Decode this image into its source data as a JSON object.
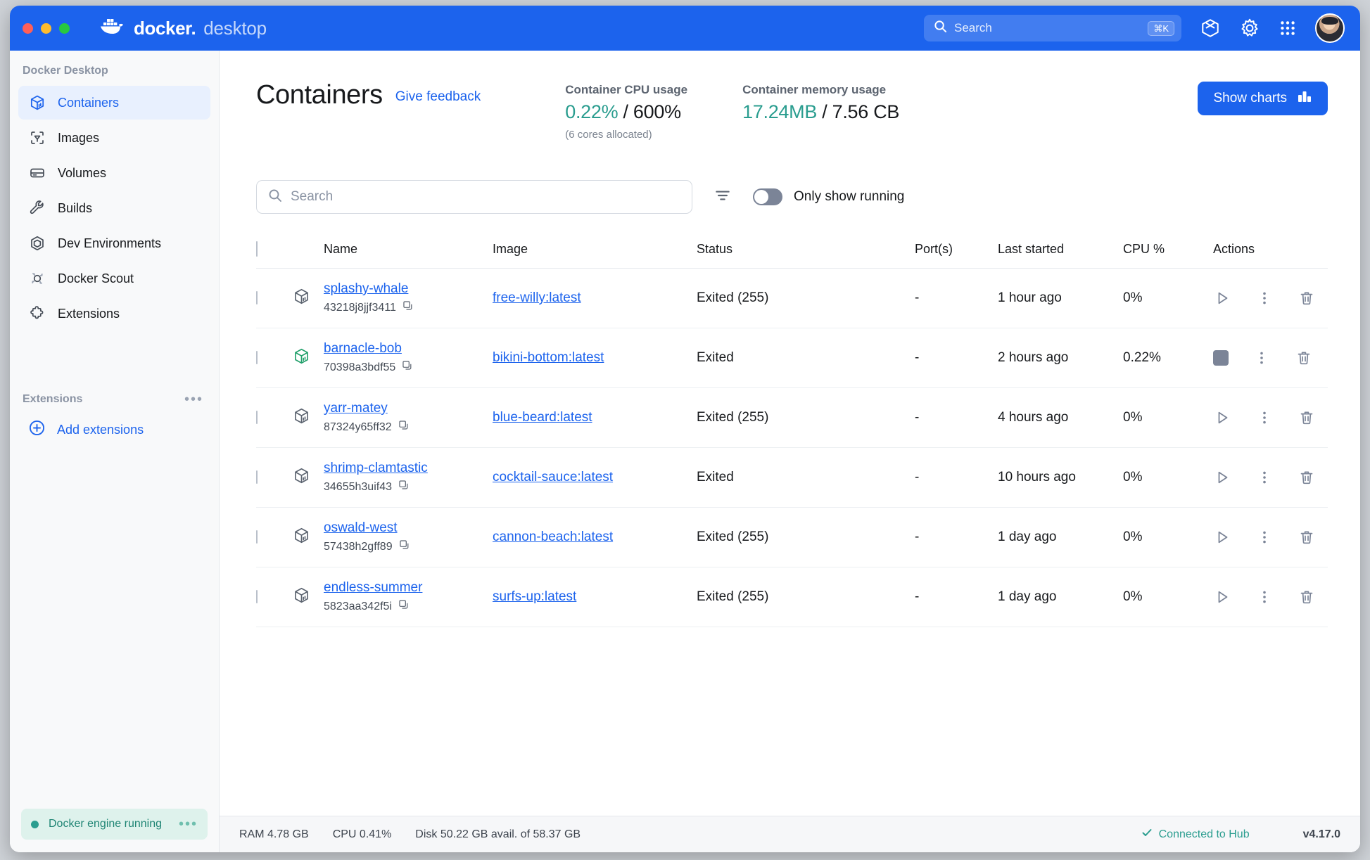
{
  "titlebar": {
    "brand_main": "docker",
    "brand_dot": ".",
    "brand_sub": "desktop",
    "search_placeholder": "Search",
    "search_shortcut": "⌘K",
    "icons": [
      "learning-center-icon",
      "gear-icon",
      "app-grid-icon",
      "avatar"
    ]
  },
  "sidebar": {
    "title": "Docker Desktop",
    "items": [
      {
        "label": "Containers",
        "icon": "container-cube-icon",
        "active": true
      },
      {
        "label": "Images",
        "icon": "images-icon",
        "active": false
      },
      {
        "label": "Volumes",
        "icon": "volumes-icon",
        "active": false
      },
      {
        "label": "Builds",
        "icon": "wrench-icon",
        "active": false
      },
      {
        "label": "Dev Environments",
        "icon": "dev-env-icon",
        "active": false
      },
      {
        "label": "Docker Scout",
        "icon": "scout-icon",
        "active": false
      },
      {
        "label": "Extensions",
        "icon": "puzzle-icon",
        "active": false
      }
    ],
    "extensions_header": "Extensions",
    "add_extensions": "Add extensions",
    "engine_status": "Docker engine running"
  },
  "main": {
    "page_title": "Containers",
    "feedback_link": "Give feedback",
    "stats": [
      {
        "label": "Container CPU usage",
        "used": "0.22%",
        "separator": " / ",
        "total": "600%",
        "sub": "(6 cores allocated)"
      },
      {
        "label": "Container memory usage",
        "used": "17.24MB",
        "separator": " / ",
        "total": "7.56 CB",
        "sub": ""
      }
    ],
    "show_charts_label": "Show charts",
    "search_placeholder": "Search",
    "only_show_running_label": "Only show running",
    "only_show_running_on": false,
    "columns": [
      "Name",
      "Image",
      "Status",
      "Port(s)",
      "Last started",
      "CPU %",
      "Actions"
    ],
    "rows": [
      {
        "name": "splashy-whale",
        "id": "43218j8jjf3411",
        "image": "free-willy:latest",
        "status": "Exited (255)",
        "ports": "-",
        "last_started": "1 hour ago",
        "cpu": "0%",
        "running": false
      },
      {
        "name": "barnacle-bob",
        "id": "70398a3bdf55",
        "image": "bikini-bottom:latest",
        "status": "Exited",
        "ports": "-",
        "last_started": "2 hours ago",
        "cpu": "0.22%",
        "running": true
      },
      {
        "name": "yarr-matey",
        "id": "87324y65ff32",
        "image": "blue-beard:latest",
        "status": "Exited (255)",
        "ports": "-",
        "last_started": "4 hours ago",
        "cpu": "0%",
        "running": false
      },
      {
        "name": "shrimp-clamtastic",
        "id": "34655h3uif43",
        "image": "cocktail-sauce:latest",
        "status": "Exited",
        "ports": "-",
        "last_started": "10 hours ago",
        "cpu": "0%",
        "running": false
      },
      {
        "name": "oswald-west",
        "id": "57438h2gff89",
        "image": "cannon-beach:latest",
        "status": "Exited (255)",
        "ports": "-",
        "last_started": "1 day ago",
        "cpu": "0%",
        "running": false
      },
      {
        "name": "endless-summer",
        "id": "5823aa342f5i",
        "image": "surfs-up:latest",
        "status": "Exited (255)",
        "ports": "-",
        "last_started": "1 day ago",
        "cpu": "0%",
        "running": false
      }
    ]
  },
  "footer": {
    "ram": "RAM 4.78 GB",
    "cpu": "CPU 0.41%",
    "disk": "Disk 50.22 GB avail. of 58.37 GB",
    "hub": "Connected to Hub",
    "version": "v4.17.0"
  },
  "colors": {
    "brand_blue": "#1c63ed",
    "accent_teal": "#2a9d8f",
    "link_blue": "#1c63ed"
  }
}
